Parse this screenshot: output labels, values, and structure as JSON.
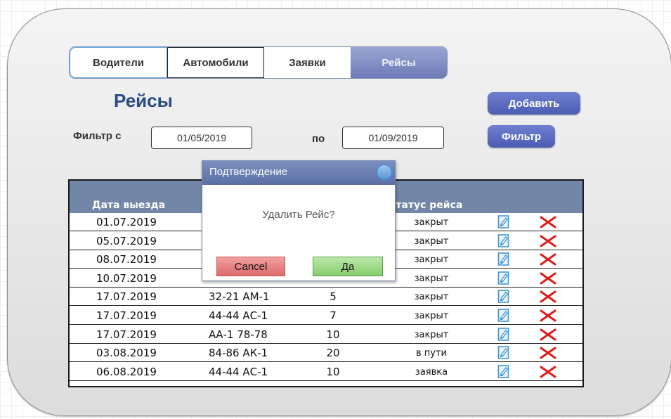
{
  "tabs": [
    {
      "label": "Водители"
    },
    {
      "label": "Автомобили"
    },
    {
      "label": "Заявки"
    },
    {
      "label": "Рейсы"
    }
  ],
  "page_title": "Рейсы",
  "buttons": {
    "add": "Добавить",
    "filter": "Фильтр"
  },
  "filter": {
    "from_label": "Фильтр с",
    "to_label": "по",
    "from_value": "01/05/2019",
    "to_value": "01/09/2019"
  },
  "table": {
    "headers": {
      "date": "Дата выезда",
      "status": "Статус рейса"
    },
    "rows": [
      {
        "date": "01.07.2019",
        "car": "",
        "num": "",
        "status": "закрыт"
      },
      {
        "date": "05.07.2019",
        "car": "",
        "num": "",
        "status": "закрыт"
      },
      {
        "date": "08.07.2019",
        "car": "",
        "num": "",
        "status": "закрыт"
      },
      {
        "date": "10.07.2019",
        "car": "",
        "num": "",
        "status": "закрыт"
      },
      {
        "date": "17.07.2019",
        "car": "32-21 АМ-1",
        "num": "5",
        "status": "закрыт"
      },
      {
        "date": "17.07.2019",
        "car": "44-44 АС-1",
        "num": "7",
        "status": "закрыт"
      },
      {
        "date": "17.07.2019",
        "car": "АА-1 78-78",
        "num": "10",
        "status": "закрыт"
      },
      {
        "date": "03.08.2019",
        "car": "84-86 АК-1",
        "num": "20",
        "status": "в пути"
      },
      {
        "date": "06.08.2019",
        "car": "44-44 АС-1",
        "num": "10",
        "status": "заявка"
      }
    ]
  },
  "dialog": {
    "title": "Подтверждение",
    "message": "Удалить Рейс?",
    "cancel": "Cancel",
    "ok": "Да"
  },
  "icons": {
    "edit": "edit-document-icon",
    "delete": "delete-x-icon"
  },
  "colors": {
    "accent": "#5a6fa5",
    "delete": "#e01b1b",
    "header": "#7386a8"
  }
}
